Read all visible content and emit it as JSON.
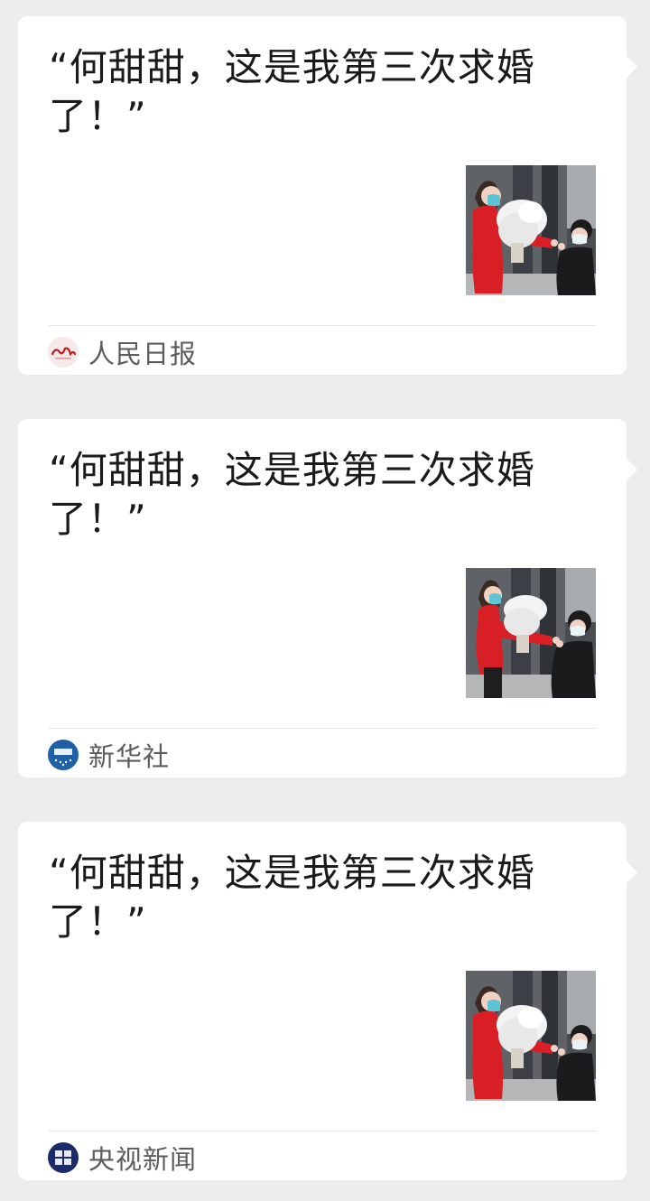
{
  "feed": {
    "articles": [
      {
        "headline": "“何甜甜，这是我第三次求婚了！”",
        "source": "人民日报",
        "source_logo": "people-daily-logo-icon",
        "logo_text": "人民日报"
      },
      {
        "headline": "“何甜甜，这是我第三次求婚了！”",
        "source": "新华社",
        "source_logo": "xinhua-logo-icon",
        "logo_text": "新华社"
      },
      {
        "headline": "“何甜甜，这是我第三次求婚了！”",
        "source": "央视新闻",
        "source_logo": "cctv-news-logo-icon",
        "logo_text": "央视新闻"
      }
    ],
    "thumbnail_subject": "woman in red coat and mask holding flowers, man kneeling proposing",
    "colors": {
      "background": "#ededed",
      "card": "#ffffff",
      "headline": "#1a1a1a",
      "source_text": "#5c5c5c",
      "people_daily_red": "#c8161d",
      "xinhua_blue": "#1f5fa8",
      "cctv_navy": "#1b2a6b"
    }
  }
}
